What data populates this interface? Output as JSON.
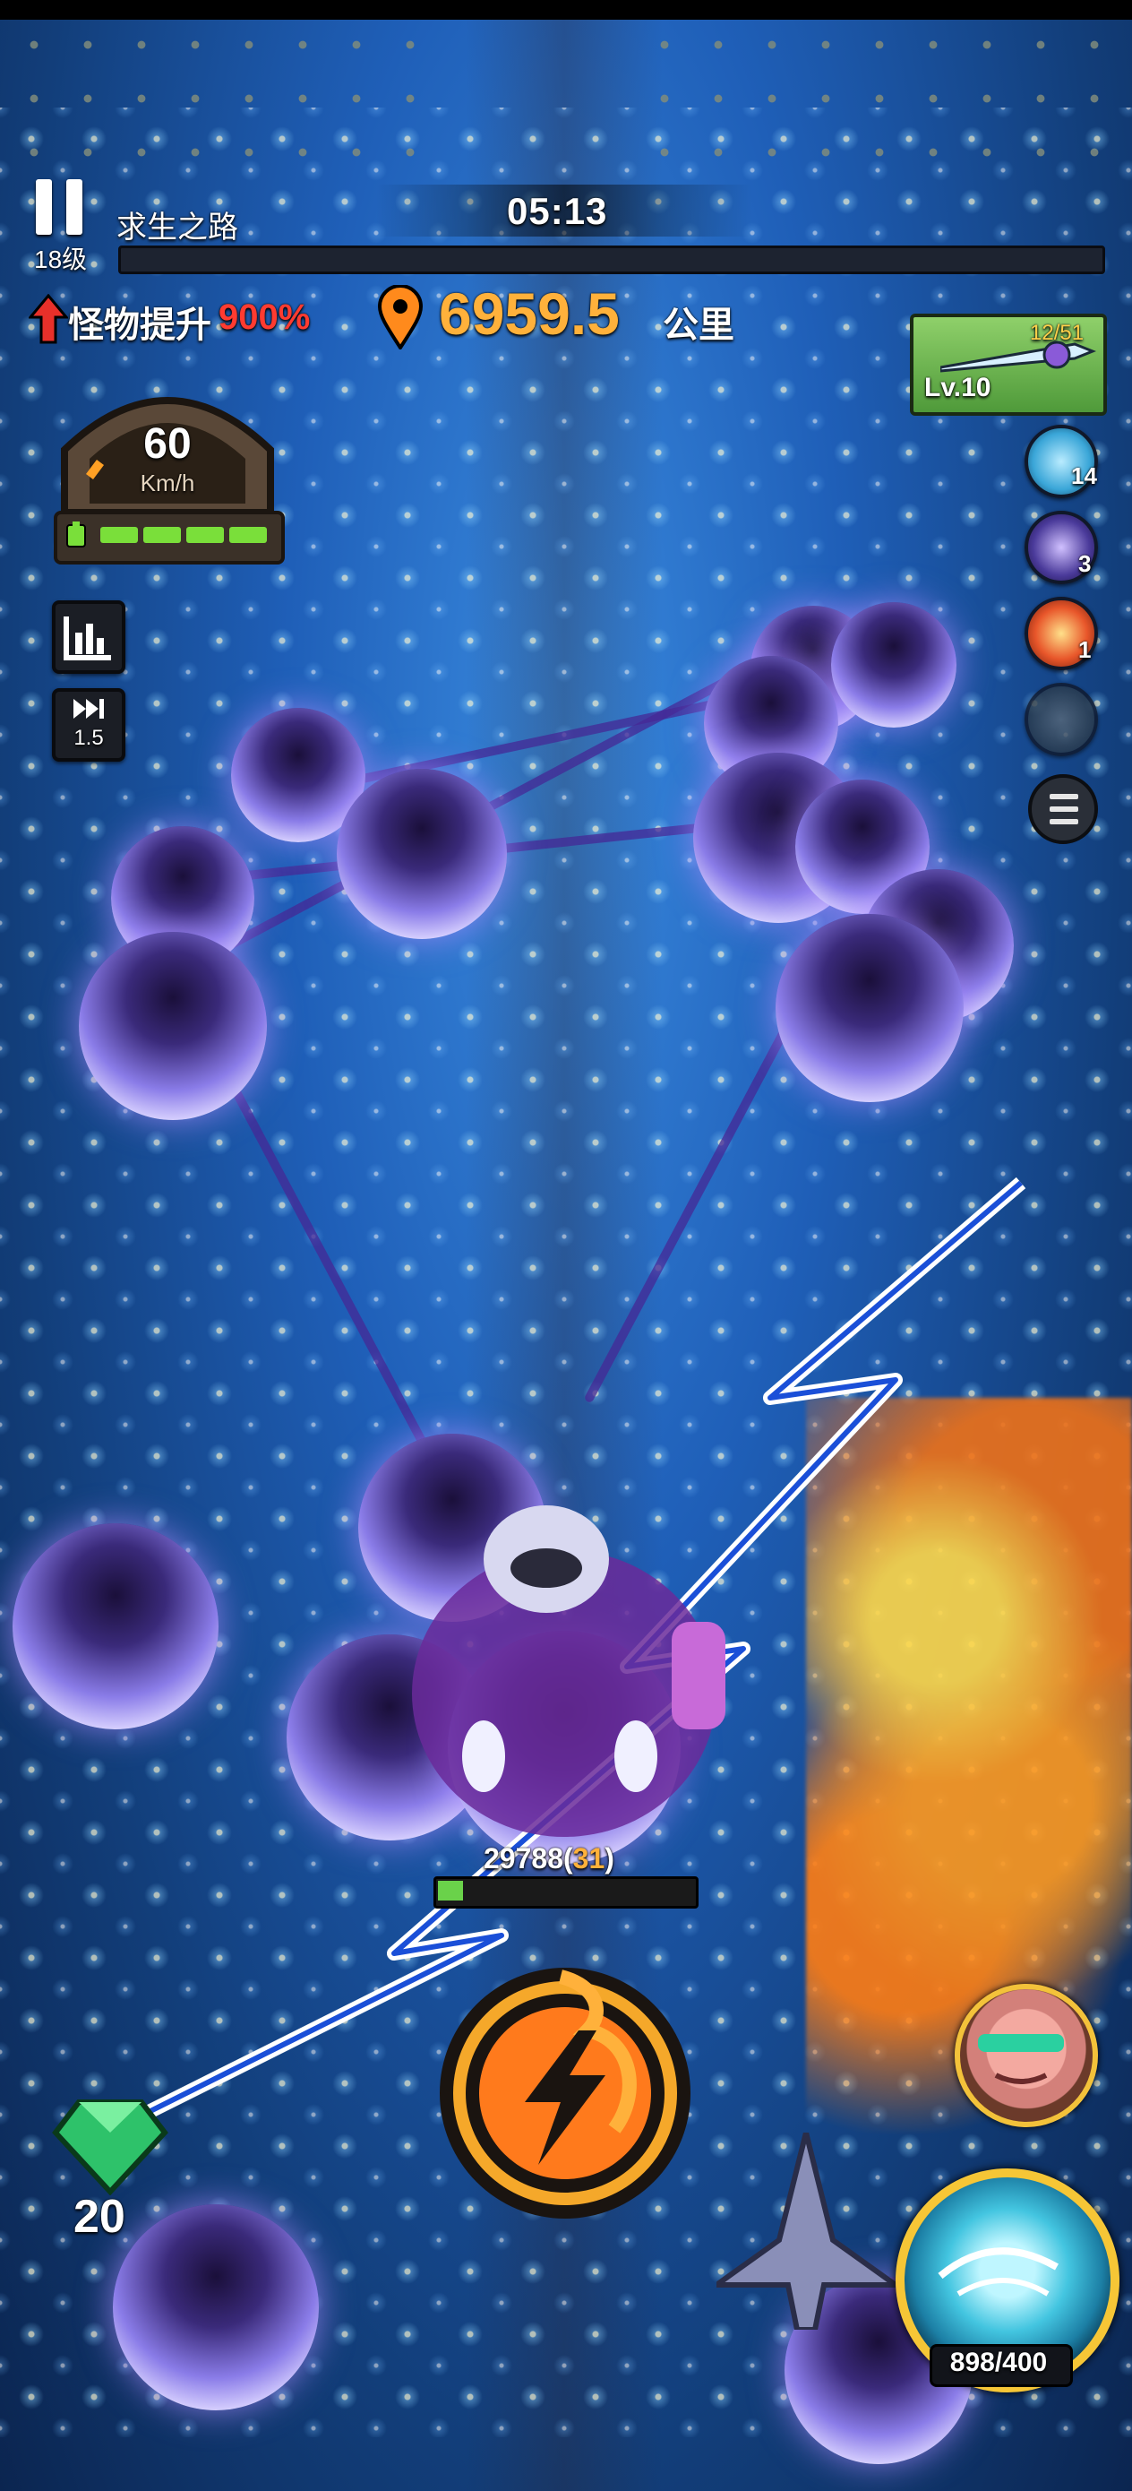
{
  "hud": {
    "level": "18级",
    "stage_name": "求生之路",
    "timer": "05:13",
    "stage_progress": 0.0,
    "monster_boost_label": "怪物提升",
    "monster_boost_value": "900%",
    "distance_value": "6959.5",
    "distance_unit": "公里"
  },
  "speedometer": {
    "speed": "60",
    "unit": "Km/h",
    "battery_cells": 4
  },
  "left_buttons": {
    "stats_icon": "bar-chart-icon",
    "speed_multiplier": "1.5"
  },
  "weapon": {
    "level": "Lv.10",
    "count": "12/51"
  },
  "skills": [
    {
      "icon": "ice-skill-icon",
      "count": "14",
      "color": "#3aa6d8"
    },
    {
      "icon": "vortex-skill-icon",
      "count": "3",
      "color": "#4a3a9a"
    },
    {
      "icon": "fire-skill-icon",
      "count": "1",
      "color": "#e8562a"
    },
    {
      "icon": "empty-skill-slot",
      "count": "",
      "color": "#3a4a5a"
    }
  ],
  "boss": {
    "hp": "29788",
    "hp_extra": "31",
    "hp_fraction": 0.1
  },
  "resources": {
    "gems": "20"
  },
  "special_skill": {
    "energy": "898/400"
  },
  "colors": {
    "accent_orange": "#ffb13b",
    "boost_red": "#ff3b30",
    "ice_blue": "#3a8be0",
    "orb_purple": "#8a7ce8"
  }
}
